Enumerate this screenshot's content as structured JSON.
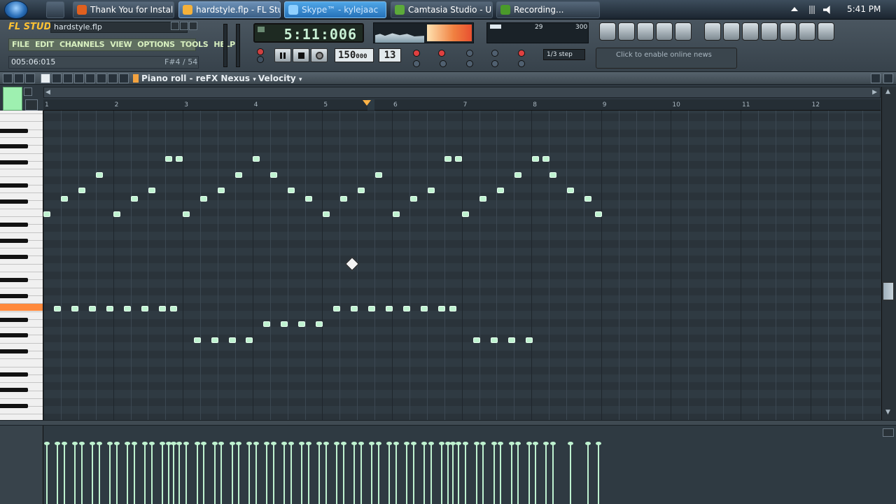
{
  "taskbar": {
    "tabs": [
      {
        "label": "Thank You for Install...",
        "active": false
      },
      {
        "label": "hardstyle.flp - FL Stu...",
        "active": true
      },
      {
        "label": "Skype™ - kylejaac",
        "active": false
      },
      {
        "label": "Camtasia Studio - U...",
        "active": false
      },
      {
        "label": "Recording...",
        "active": false
      }
    ],
    "clock": "5:41 PM"
  },
  "fl": {
    "logo": "FL STUDIO",
    "project_name": "hardstyle.flp",
    "menu": [
      "FILE",
      "EDIT",
      "CHANNELS",
      "VIEW",
      "OPTIONS",
      "TOOLS",
      "HELP"
    ],
    "song_time": "005:06:015",
    "note_hint": "F#4 / 54",
    "lcd_time": "5:11:006",
    "tempo": "150",
    "tempo_frac": "000",
    "pattern": "13",
    "snap": "1/3 step",
    "cpu_left": "29",
    "cpu_right": "300",
    "news": "Click to enable online news"
  },
  "piano_roll": {
    "title": "Piano roll - reFX Nexus",
    "dropdown": "Velocity",
    "bar_numbers": [
      "1",
      "2",
      "3",
      "4",
      "5",
      "6",
      "7",
      "8",
      "9",
      "10",
      "11",
      "12"
    ]
  },
  "colors": {
    "note": "#bff2d0",
    "grid_bg": "#2f3a42",
    "accent": "#ffb347"
  }
}
